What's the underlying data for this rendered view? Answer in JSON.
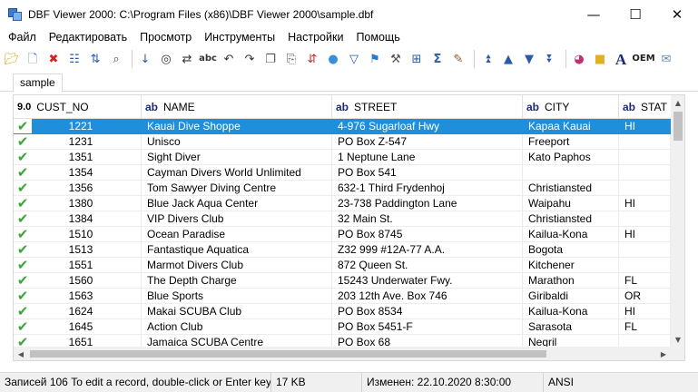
{
  "window": {
    "title": "DBF Viewer 2000: C:\\Program Files (x86)\\DBF Viewer 2000\\sample.dbf",
    "minimize_glyph": "—",
    "maximize_glyph": "☐",
    "close_glyph": "✕"
  },
  "menu": [
    "Файл",
    "Редактировать",
    "Просмотр",
    "Инструменты",
    "Настройки",
    "Помощь"
  ],
  "toolbar": {
    "icons": [
      "open-icon",
      "new-file-icon",
      "delete-icon",
      "structure-icon",
      "sort-icon",
      "find-icon",
      "goto-icon",
      "search-binoculars-icon",
      "replace-icon",
      "spell-icon",
      "undo-icon",
      "redo-icon",
      "copy-icon",
      "paste-icon",
      "sort-az-icon",
      "comment-icon",
      "filter-icon",
      "column-icon",
      "tools-icon",
      "table-icon",
      "sum-icon",
      "brush-icon",
      "first-record-icon",
      "prev-record-icon",
      "next-record-icon",
      "last-record-icon",
      "color-icon",
      "highlight-icon",
      "font-icon",
      "oem-icon",
      "chart-icon"
    ],
    "oem_label": "OEM",
    "font_label": "A"
  },
  "tab": {
    "label": "sample"
  },
  "grid": {
    "columns": [
      {
        "type": "9.0",
        "name": "CUST_NO"
      },
      {
        "type": "ab",
        "name": "NAME"
      },
      {
        "type": "ab",
        "name": "STREET"
      },
      {
        "type": "ab",
        "name": "CITY"
      },
      {
        "type": "ab",
        "name": "STAT"
      }
    ],
    "check_glyph": "✔",
    "rows": [
      {
        "id": "1221",
        "name": "Kauai Dive Shoppe",
        "street": "4-976 Sugarloaf Hwy",
        "city": "Kapaa Kauai",
        "state": "HI",
        "selected": true
      },
      {
        "id": "1231",
        "name": "Unisco",
        "street": "PO Box Z-547",
        "city": "Freeport",
        "state": ""
      },
      {
        "id": "1351",
        "name": "Sight Diver",
        "street": "1 Neptune Lane",
        "city": "Kato Paphos",
        "state": ""
      },
      {
        "id": "1354",
        "name": "Cayman Divers World Unlimited",
        "street": "PO Box 541",
        "city": "",
        "state": ""
      },
      {
        "id": "1356",
        "name": "Tom Sawyer Diving Centre",
        "street": "632-1 Third Frydenhoj",
        "city": "Christiansted",
        "state": ""
      },
      {
        "id": "1380",
        "name": "Blue Jack Aqua Center",
        "street": "23-738 Paddington Lane",
        "city": "Waipahu",
        "state": "HI"
      },
      {
        "id": "1384",
        "name": "VIP Divers Club",
        "street": "32 Main St.",
        "city": "Christiansted",
        "state": ""
      },
      {
        "id": "1510",
        "name": "Ocean Paradise",
        "street": "PO Box 8745",
        "city": "Kailua-Kona",
        "state": "HI"
      },
      {
        "id": "1513",
        "name": "Fantastique Aquatica",
        "street": "Z32 999 #12A-77 A.A.",
        "city": "Bogota",
        "state": ""
      },
      {
        "id": "1551",
        "name": "Marmot Divers Club",
        "street": "872 Queen St.",
        "city": "Kitchener",
        "state": ""
      },
      {
        "id": "1560",
        "name": "The Depth Charge",
        "street": "15243 Underwater Fwy.",
        "city": "Marathon",
        "state": "FL"
      },
      {
        "id": "1563",
        "name": "Blue Sports",
        "street": "203 12th Ave. Box 746",
        "city": "Giribaldi",
        "state": "OR"
      },
      {
        "id": "1624",
        "name": "Makai SCUBA Club",
        "street": "PO Box 8534",
        "city": "Kailua-Kona",
        "state": "HI"
      },
      {
        "id": "1645",
        "name": "Action Club",
        "street": "PO Box 5451-F",
        "city": "Sarasota",
        "state": "FL"
      },
      {
        "id": "1651",
        "name": "Jamaica SCUBA Centre",
        "street": "PO Box 68",
        "city": "Negril",
        "state": ""
      }
    ]
  },
  "status": {
    "records": "Записей 106 To edit a record, double-click or Enter key",
    "size": "17 KB",
    "modified": "Изменен: 22.10.2020 8:30:00",
    "encoding": "ANSI"
  }
}
